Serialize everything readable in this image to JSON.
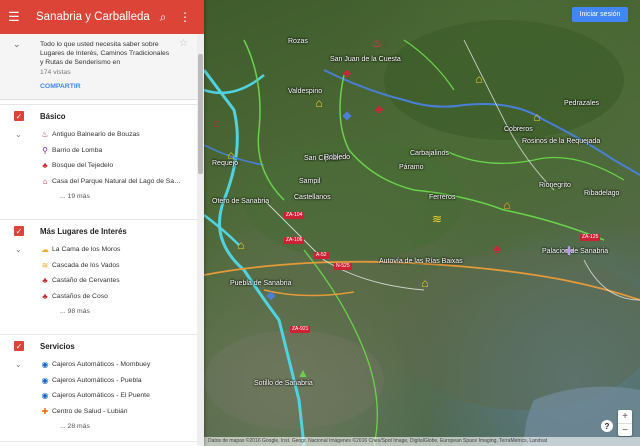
{
  "header": {
    "title": "Sanabria y Carballeda",
    "menu_icon": "hamburger-menu-icon",
    "search_icon": "search-icon",
    "more_icon": "more-vert-icon",
    "accent_color": "#db4437"
  },
  "description": {
    "text": "Todo lo que usted necesita saber sobre Lugares de Interés, Caminos Tradicionales y Rutas de Senderismo en",
    "views": "174 vistas",
    "share_label": "COMPARTIR"
  },
  "layers": [
    {
      "title": "Básico",
      "items": [
        {
          "label": "Antiguo Balneario de Bouzas",
          "icon": "spa-icon",
          "color": "#c2185b"
        },
        {
          "label": "Barrio de Lomba",
          "icon": "pin-icon",
          "color": "#7b1fa2"
        },
        {
          "label": "Bosque del Tejedelo",
          "icon": "tree-icon",
          "color": "#c62828"
        },
        {
          "label": "Casa del Parque Natural del Lago de Sa…",
          "icon": "house-icon",
          "color": "#c62828"
        }
      ],
      "more": "... 19 más"
    },
    {
      "title": "Más Lugares de Interés",
      "items": [
        {
          "label": "La Cama de los Moros",
          "icon": "cloud-icon",
          "color": "#f9a825"
        },
        {
          "label": "Cascada de los Vados",
          "icon": "waves-icon",
          "color": "#f9a825"
        },
        {
          "label": "Castaño de Cervantes",
          "icon": "tree-icon",
          "color": "#c62828"
        },
        {
          "label": "Castaños de Coso",
          "icon": "tree-icon",
          "color": "#c62828"
        }
      ],
      "more": "... 98 más"
    },
    {
      "title": "Servicios",
      "items": [
        {
          "label": "Cajeros Automáticos - Mombuey",
          "icon": "atm-icon",
          "color": "#1565c0"
        },
        {
          "label": "Cajeros Automáticos - Puebla",
          "icon": "atm-icon",
          "color": "#1565c0"
        },
        {
          "label": "Cajeros Automáticos - El Puente",
          "icon": "atm-icon",
          "color": "#1565c0"
        },
        {
          "label": "Centro de Salud - Lubián",
          "icon": "health-cross-icon",
          "color": "#ef6c00"
        }
      ],
      "more": "... 28 más"
    }
  ],
  "map": {
    "signin_label": "Iniciar sesión",
    "places": [
      "Rozas",
      "San Juan de la Cuesta",
      "Valdespino",
      "San Ciprián",
      "Robledo",
      "Cobreros",
      "Sampil",
      "Castellanos",
      "Carbajalinos",
      "Páramo",
      "Ferreros",
      "Pedrazales",
      "Rionegrito",
      "Otero de Sanabria",
      "Palacios de Sanabria",
      "Puebla de Sanabria",
      "Sotillo de Sanabria",
      "Requejo",
      "Ribadelago",
      "Rosinos de la Requejada",
      "Autovía de las Rías Baixas"
    ],
    "roads": [
      "ZA-104",
      "ZA-106",
      "A-52",
      "N-525",
      "ZA-125",
      "ZA-921"
    ],
    "zoom_in": "+",
    "zoom_out": "−",
    "help": "?",
    "attribution": "Datos de mapas ©2016 Google, Inst. Geogr. Nacional Imágenes ©2016 Cnes/Spot Image, DigitalGlobe, European Space Imaging, TerraMetrics, Landsat"
  }
}
